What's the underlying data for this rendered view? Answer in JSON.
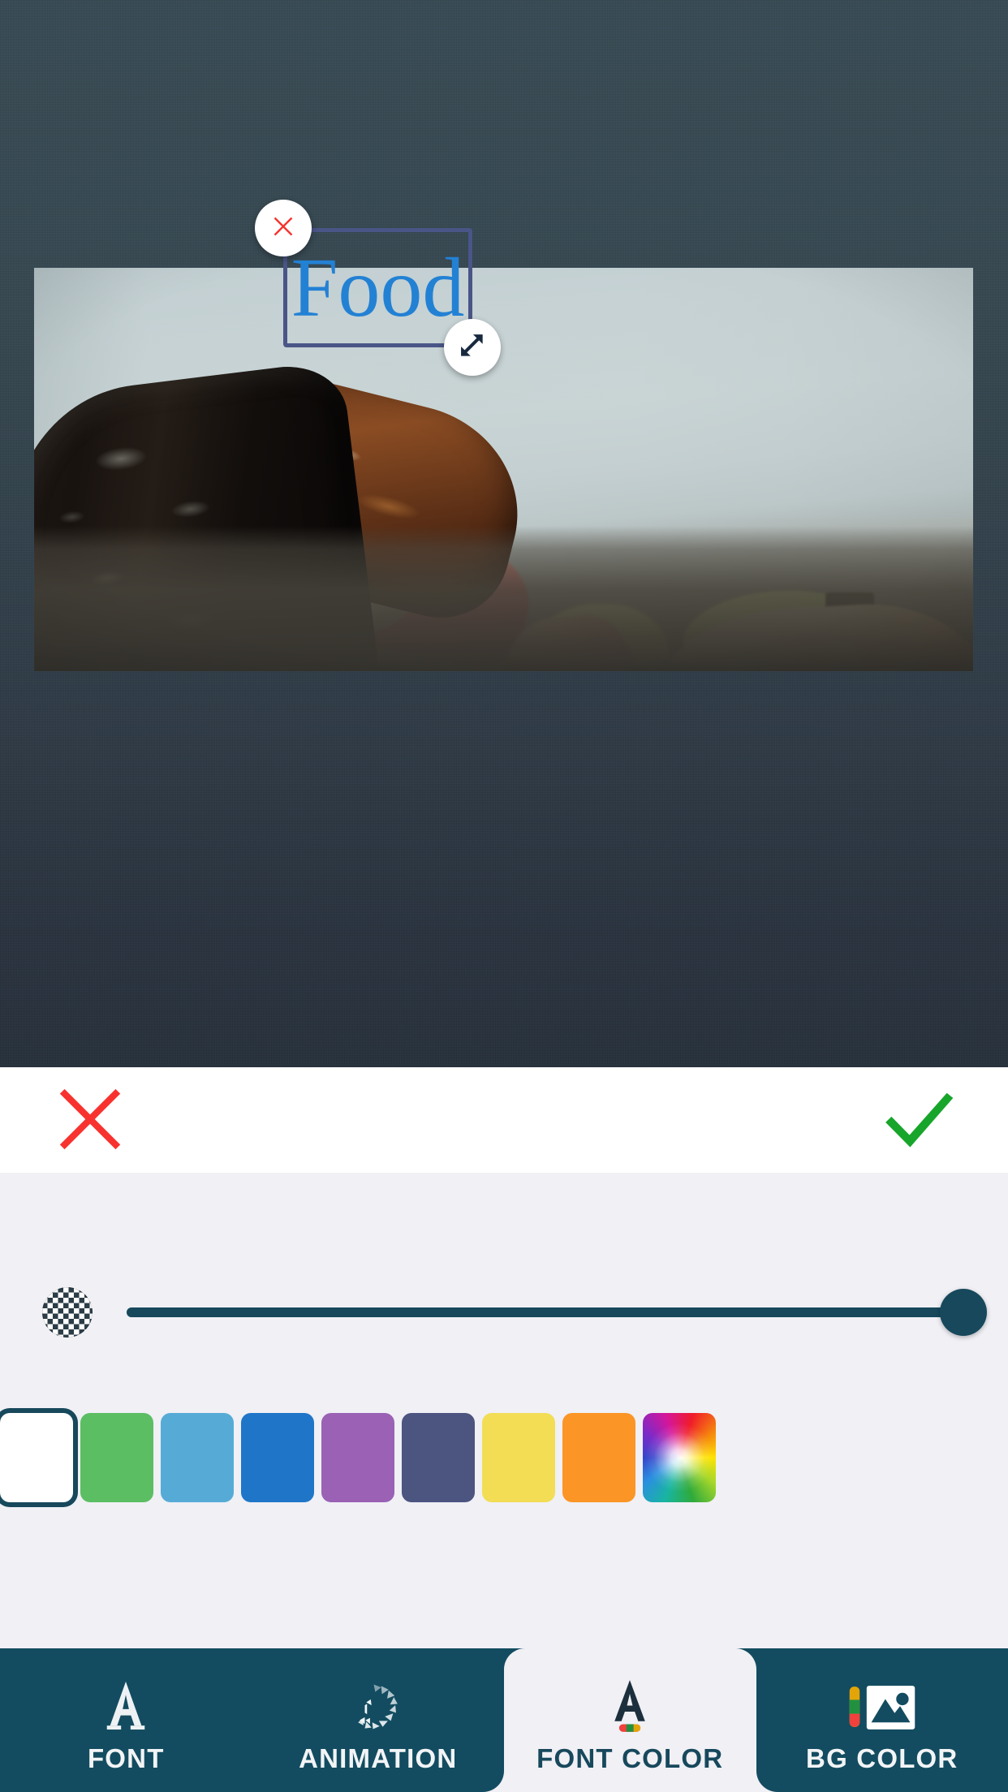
{
  "canvas": {
    "background_color": "#3a4c56",
    "photo": {
      "alt_description": "close-up of sushi nigiri pieces on a dark table",
      "subject": "sushi"
    }
  },
  "text_object": {
    "text": "Food",
    "font_color": "#2381d4",
    "box_border_color": "#4a5587",
    "delete_icon": "close-x-icon",
    "resize_icon": "resize-diagonal-icon"
  },
  "confirm_bar": {
    "cancel_icon": "red-x-icon",
    "cancel_color": "#f8332f",
    "confirm_icon": "green-check-icon",
    "confirm_color": "#17a52b"
  },
  "opacity_slider": {
    "transparent_icon": "checkerboard-transparency-icon",
    "value": 100,
    "min": 0,
    "max": 100,
    "track_color": "#17485c",
    "thumb_color": "#17485c"
  },
  "swatches": {
    "selected_index": 0,
    "items": [
      {
        "name": "white",
        "color": "#ffffff",
        "selected": true
      },
      {
        "name": "green",
        "color": "#5cbe63",
        "selected": false
      },
      {
        "name": "light-blue",
        "color": "#56ackd",
        "selected": false
      },
      {
        "name": "blue",
        "color": "#1f76c8",
        "selected": false
      },
      {
        "name": "purple",
        "color": "#9a61b5",
        "selected": false
      },
      {
        "name": "indigo",
        "color": "#4c5480",
        "selected": false
      },
      {
        "name": "yellow",
        "color": "#f2dd55",
        "selected": false
      },
      {
        "name": "orange",
        "color": "#fb9526",
        "selected": false
      },
      {
        "name": "color-wheel",
        "color": "wheel",
        "selected": false
      }
    ]
  },
  "tabbar": {
    "active": "FONT COLOR",
    "tabs": [
      {
        "label": "FONT",
        "icon": "letter-a-icon",
        "active": false
      },
      {
        "label": "ANIMATION",
        "icon": "motion-swirl-icon",
        "active": false
      },
      {
        "label": "FONT COLOR",
        "icon": "letter-a-color-icon",
        "active": true
      },
      {
        "label": "BG COLOR",
        "icon": "image-color-icon",
        "active": false
      }
    ]
  }
}
